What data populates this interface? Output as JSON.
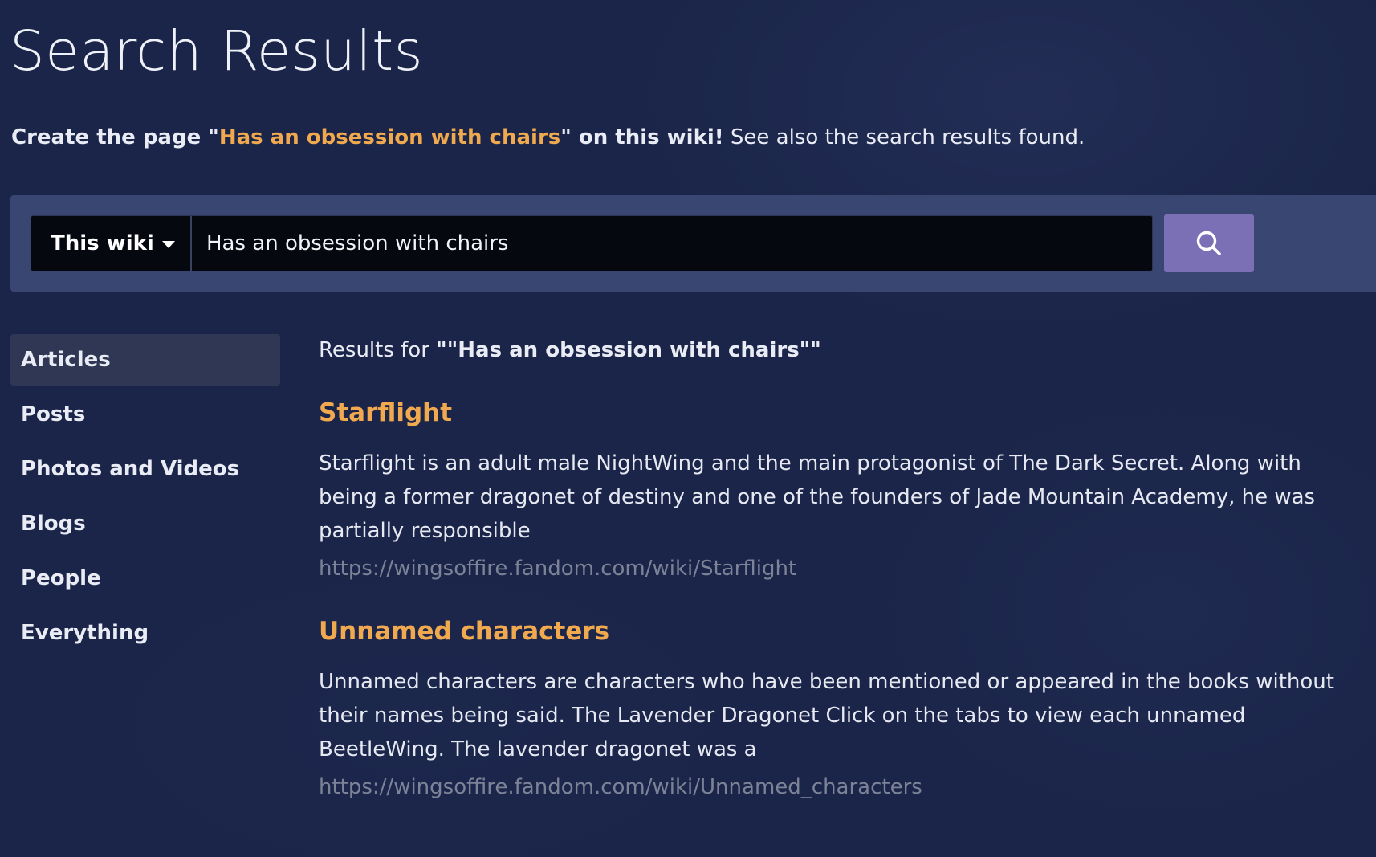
{
  "page": {
    "title": "Search Results"
  },
  "create": {
    "prefix": "Create the page \"",
    "link": "Has an obsession with chairs",
    "suffix": "\" on this wiki!",
    "see_also": " See also the search results found."
  },
  "search": {
    "scope_label": "This wiki",
    "query": "Has an obsession with chairs",
    "button_icon": "search-icon"
  },
  "sidebar": {
    "items": [
      {
        "label": "Articles",
        "active": true
      },
      {
        "label": "Posts",
        "active": false
      },
      {
        "label": "Photos and Videos",
        "active": false
      },
      {
        "label": "Blogs",
        "active": false
      },
      {
        "label": "People",
        "active": false
      },
      {
        "label": "Everything",
        "active": false
      }
    ]
  },
  "results": {
    "prefix": "Results for ",
    "query_display": "\"\"Has an obsession with chairs\"\"",
    "items": [
      {
        "title": "Starflight",
        "snippet": "Starflight is an adult male NightWing and the main protagonist of The Dark Secret. Along with being a former dragonet of destiny and one of the founders of Jade Mountain Academy, he was partially responsible",
        "url": "https://wingsoffire.fandom.com/wiki/Starflight"
      },
      {
        "title": "Unnamed characters",
        "snippet": "Unnamed characters are characters who have been mentioned or appeared in the books without their names being said. The Lavender Dragonet Click on the tabs to view each unnamed BeetleWing. The lavender dragonet was a",
        "url": "https://wingsoffire.fandom.com/wiki/Unnamed_characters"
      }
    ]
  },
  "colors": {
    "background": "#1b2549",
    "accent_link": "#f0a94e",
    "search_button": "#7b6fb6",
    "url_text": "#7c8397"
  }
}
